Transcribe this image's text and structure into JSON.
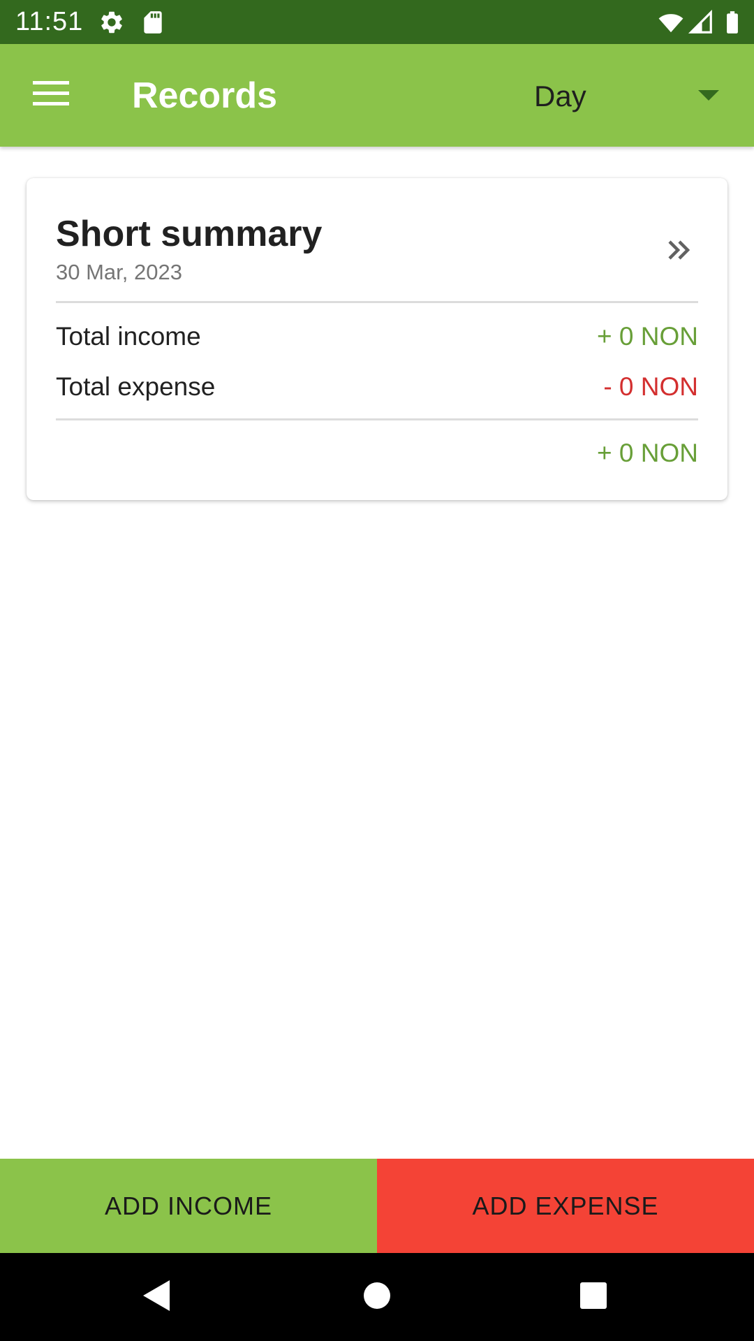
{
  "status_bar": {
    "time": "11:51",
    "icons": [
      "settings-icon",
      "sd-card-icon",
      "wifi-icon",
      "signal-icon",
      "battery-icon"
    ],
    "background": "#33691e"
  },
  "app_bar": {
    "title": "Records",
    "period_selected": "Day",
    "icons": [
      "menu-icon",
      "dropdown-arrow-icon"
    ],
    "background": "#8bc34a"
  },
  "summary": {
    "title": "Short summary",
    "date": "30 Mar, 2023",
    "details_icon": "double-chevron-right-icon",
    "income_label": "Total income",
    "income_value": "+ 0 NON",
    "expense_label": "Total expense",
    "expense_value": "- 0 NON",
    "balance_value": "+ 0 NON",
    "income_color": "#689f38",
    "expense_color": "#d32f2f"
  },
  "actions": {
    "add_income": "ADD INCOME",
    "add_expense": "ADD EXPENSE",
    "income_color": "#8bc34a",
    "expense_color": "#f44336"
  },
  "nav_bar": {
    "icons": [
      "back-icon",
      "home-icon",
      "recents-icon"
    ]
  }
}
